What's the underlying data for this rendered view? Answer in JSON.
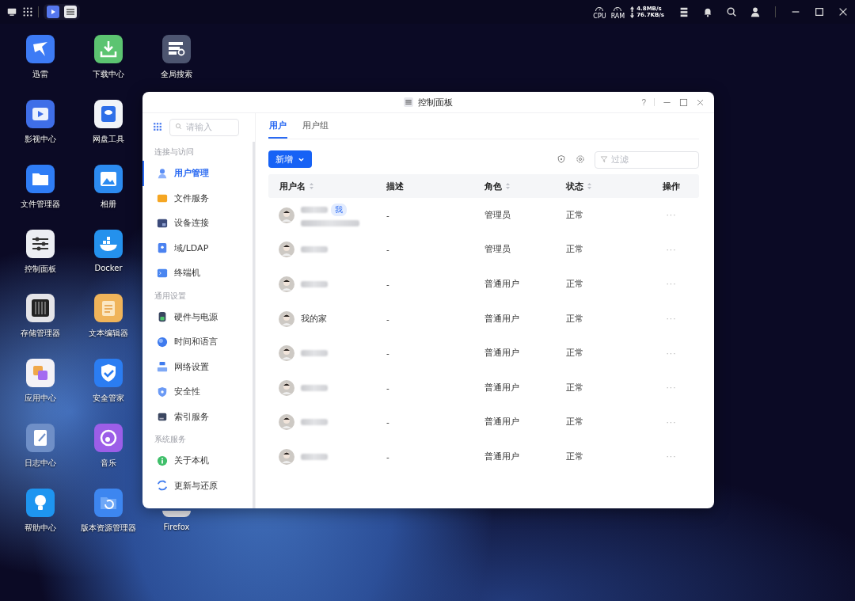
{
  "top_bar": {
    "cpu_label": "CPU",
    "ram_label": "RAM",
    "upload": "4.8MB/s",
    "download": "76.7KB/s"
  },
  "desktop": {
    "columns": [
      [
        "迅雷",
        "影视中心",
        "文件管理器",
        "控制面板",
        "存储管理器",
        "应用中心",
        "日志中心",
        "帮助中心"
      ],
      [
        "下载中心",
        "网盘工具",
        "相册",
        "Docker",
        "文本编辑器",
        "安全管家",
        "音乐",
        "版本资源管理器"
      ],
      [
        "全局搜索",
        "Firefox"
      ]
    ]
  },
  "window": {
    "title": "控制面板",
    "help": "?",
    "sidebar": {
      "search_placeholder": "请输入",
      "sections": [
        {
          "title": "连接与访问",
          "items": [
            {
              "label": "用户管理",
              "selected": true
            },
            {
              "label": "文件服务",
              "selected": false
            },
            {
              "label": "设备连接",
              "selected": false
            },
            {
              "label": "域/LDAP",
              "selected": false
            },
            {
              "label": "终端机",
              "selected": false
            }
          ]
        },
        {
          "title": "通用设置",
          "items": [
            {
              "label": "硬件与电源",
              "selected": false
            },
            {
              "label": "时间和语言",
              "selected": false
            },
            {
              "label": "网络设置",
              "selected": false
            },
            {
              "label": "安全性",
              "selected": false
            },
            {
              "label": "索引服务",
              "selected": false
            }
          ]
        },
        {
          "title": "系统服务",
          "items": [
            {
              "label": "关于本机",
              "selected": false
            },
            {
              "label": "更新与还原",
              "selected": false
            }
          ]
        }
      ]
    },
    "tabs": [
      {
        "label": "用户",
        "selected": true
      },
      {
        "label": "用户组",
        "selected": false
      }
    ],
    "add_button": "新增",
    "filter_placeholder": "过滤",
    "table": {
      "columns": [
        {
          "label": "用户名",
          "sortable": true
        },
        {
          "label": "描述",
          "sortable": false
        },
        {
          "label": "角色",
          "sortable": true
        },
        {
          "label": "状态",
          "sortable": true
        },
        {
          "label": "操作",
          "sortable": false
        }
      ],
      "rows": [
        {
          "name_redacted": true,
          "badge": "我",
          "email_redacted": true,
          "description": "-",
          "role": "管理员",
          "status": "正常",
          "actions": "···"
        },
        {
          "name_redacted": true,
          "description": "-",
          "role": "管理员",
          "status": "正常",
          "actions": "···"
        },
        {
          "name_redacted": true,
          "description": "-",
          "role": "普通用户",
          "status": "正常",
          "actions": "···"
        },
        {
          "name": "我的家",
          "description": "-",
          "role": "普通用户",
          "status": "正常",
          "actions": "···"
        },
        {
          "name_redacted": true,
          "description": "-",
          "role": "普通用户",
          "status": "正常",
          "actions": "···"
        },
        {
          "name_redacted": true,
          "description": "-",
          "role": "普通用户",
          "status": "正常",
          "actions": "···"
        },
        {
          "name_redacted": true,
          "description": "-",
          "role": "普通用户",
          "status": "正常",
          "actions": "···"
        },
        {
          "name_redacted": true,
          "description": "-",
          "role": "普通用户",
          "status": "正常",
          "actions": "···"
        }
      ]
    }
  }
}
